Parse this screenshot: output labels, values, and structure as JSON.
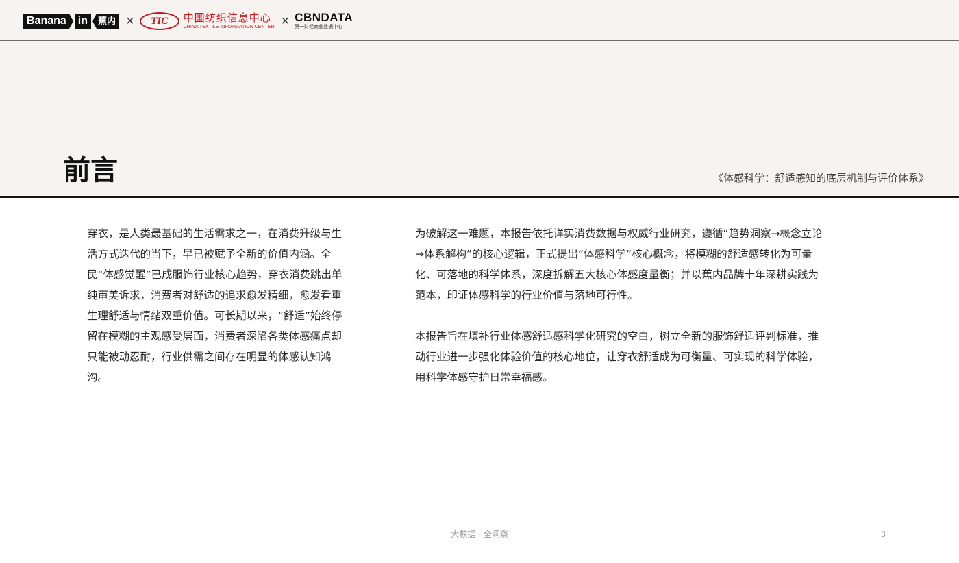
{
  "header": {
    "logos": {
      "banana_word": "Banana",
      "banana_in": "in",
      "banana_cn": "蕉内",
      "separator": "×",
      "ctic_mark": "TIC",
      "ctic_cn": "中国纺织信息中心",
      "ctic_en": "CHINA TEXTILE INFORMATION CENTER",
      "cbn_name": "CBNDATA",
      "cbn_sub": "第一财经商业数据中心"
    }
  },
  "page": {
    "title": "前言",
    "report_name": "《体感科学：舒适感知的底层机制与评价体系》"
  },
  "content": {
    "left_paragraph": "穿衣，是人类最基础的生活需求之一，在消费升级与生活方式迭代的当下，早已被赋予全新的价值内涵。全民“体感觉醒”已成服饰行业核心趋势，穿衣消费跳出单纯审美诉求，消费者对舒适的追求愈发精细，愈发看重生理舒适与情绪双重价值。可长期以来，“舒适”始终停留在模糊的主观感受层面，消费者深陷各类体感痛点却只能被动忍耐，行业供需之间存在明显的体感认知鸿沟。",
    "right_paragraph_1": "为破解这一难题，本报告依托详实消费数据与权威行业研究，遵循“趋势洞察→概念立论→体系解构”的核心逻辑，正式提出“体感科学”核心概念，将模糊的舒适感转化为可量化、可落地的科学体系，深度拆解五大核心体感度量衡；并以蕉内品牌十年深耕实践为范本，印证体感科学的行业价值与落地可行性。",
    "right_paragraph_2": "本报告旨在填补行业体感舒适感科学化研究的空白，树立全新的服饰舒适评判标准，推动行业进一步强化体验价值的核心地位，让穿衣舒适成为可衡量、可实现的科学体验，用科学体感守护日常幸福感。"
  },
  "footer": {
    "tagline": "大数据 · 全洞察",
    "page_number": "3"
  },
  "colors": {
    "band": "#f6f3f0",
    "ctic_red": "#c8161d",
    "rule": "#141414"
  }
}
